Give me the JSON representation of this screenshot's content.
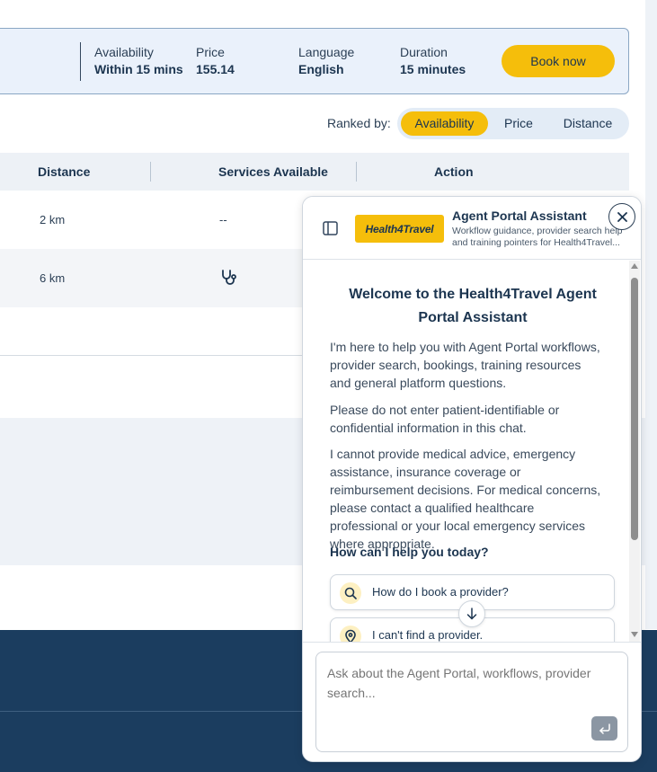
{
  "summary": {
    "availability_label": "Availability",
    "availability_value": "Within 15 mins",
    "price_label": "Price",
    "price_value": "155.14",
    "language_label": "Language",
    "language_value": "English",
    "duration_label": "Duration",
    "duration_value": "15 minutes",
    "book_button": "Book now"
  },
  "ranking": {
    "label": "Ranked by:",
    "options": [
      "Availability",
      "Price",
      "Distance"
    ],
    "active": "Availability"
  },
  "table": {
    "headers": [
      "Distance",
      "Services Available",
      "Action"
    ],
    "rows": [
      {
        "distance": "2 km",
        "services": "--"
      },
      {
        "distance": "6 km",
        "services_icon": "stethoscope-icon"
      }
    ]
  },
  "assistant": {
    "logo_text": "Health4Travel",
    "title": "Agent Portal Assistant",
    "subtitle_line1": "Workflow guidance, provider search help",
    "subtitle_line2": "and training pointers for Health4Travel...",
    "welcome_heading": "Welcome to the Health4Travel Agent Portal Assistant",
    "intro": "I'm here to help you with Agent Portal workflows, provider search, bookings, training resources and general platform questions.",
    "privacy_note": "Please do not enter patient-identifiable or confidential information in this chat.",
    "disclaimer": "I cannot provide medical advice, emergency assistance, insurance coverage or reimbursement decisions. For medical concerns, please contact a qualified healthcare professional or your local emergency services where appropriate.",
    "help_heading": "How can I help you today?",
    "suggestions": [
      {
        "label": "How do I book a provider?",
        "icon": "search-icon"
      },
      {
        "label": "I can't find a provider.",
        "icon": "location-pin-icon"
      }
    ],
    "input_placeholder": "Ask about the Agent Portal, workflows, provider search..."
  },
  "colors": {
    "accent": "#f5be0b",
    "navy": "#1b3d5f",
    "text": "#1c3550"
  }
}
